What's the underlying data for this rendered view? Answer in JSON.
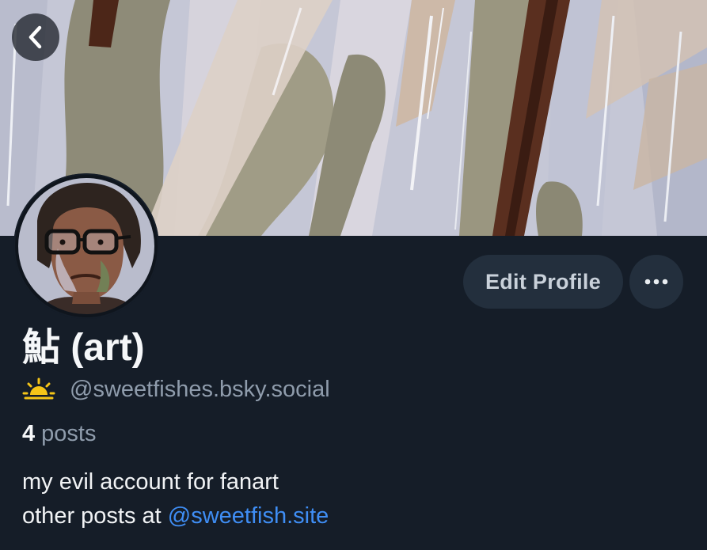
{
  "profile": {
    "display_name": "鮎 (art)",
    "handle": "@sweetfishes.bsky.social",
    "handle_icon": "sunrise-icon",
    "posts_count": "4",
    "posts_label": "posts",
    "bio_line_1": "my evil account for fanart",
    "bio_line_2_prefix": "other posts at",
    "bio_link": "@sweetfish.site"
  },
  "actions": {
    "edit_profile_label": "Edit Profile",
    "back_icon": "chevron-left-icon",
    "more_icon": "ellipsis-icon"
  },
  "colors": {
    "background": "#151d28",
    "button_bg": "#232f3d",
    "link": "#3f8ef5",
    "muted_text": "#8f9cac",
    "sun_icon": "#f5c518"
  }
}
